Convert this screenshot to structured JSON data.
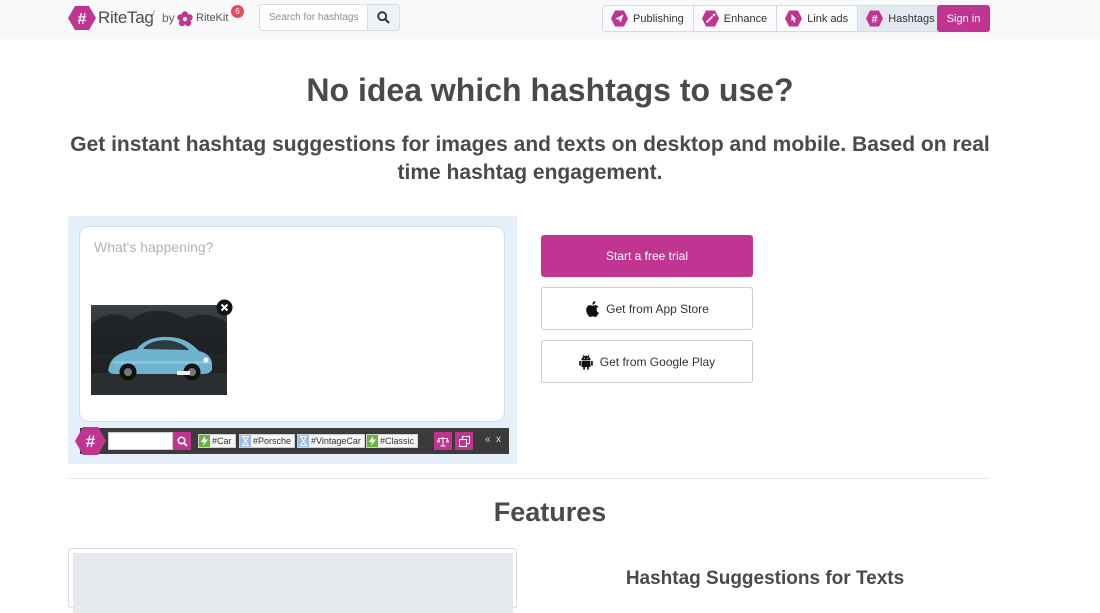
{
  "header": {
    "logo_text": "RiteTag",
    "slash": "/",
    "by_label": "by",
    "ritekit_text": "RiteKit",
    "notification_count": "6",
    "search_placeholder": "Search for hashtags",
    "nav": [
      {
        "label": "Publishing",
        "icon": "paper-plane-icon"
      },
      {
        "label": "Enhance",
        "icon": "wand-icon"
      },
      {
        "label": "Link ads",
        "icon": "pointer-icon"
      },
      {
        "label": "Hashtags",
        "icon": "hashtag-icon",
        "active": true
      }
    ],
    "signin_label": "Sign in"
  },
  "hero": {
    "title": "No idea which hashtags to use?",
    "subtitle": "Get instant hashtag suggestions for images and texts on desktop and mobile. Based on real time hashtag engagement."
  },
  "demo": {
    "compose_placeholder": "What's happening?",
    "tags": [
      {
        "text": "#Car",
        "status": "green"
      },
      {
        "text": "#Porsche",
        "status": "blue"
      },
      {
        "text": "#VintageCar",
        "status": "blue"
      },
      {
        "text": "#Classic",
        "status": "green"
      }
    ],
    "collapse_label": "«",
    "close_label": "x"
  },
  "cta": {
    "trial_label": "Start a free trial",
    "appstore_label": "Get from App Store",
    "googleplay_label": "Get from Google Play"
  },
  "features": {
    "heading": "Features",
    "first_title": "Hashtag Suggestions for Texts"
  },
  "colors": {
    "brand": "#c03592",
    "tag_green": "#67b43f",
    "tag_blue": "#9cbde6",
    "frame_bg": "#e6f0fb"
  }
}
